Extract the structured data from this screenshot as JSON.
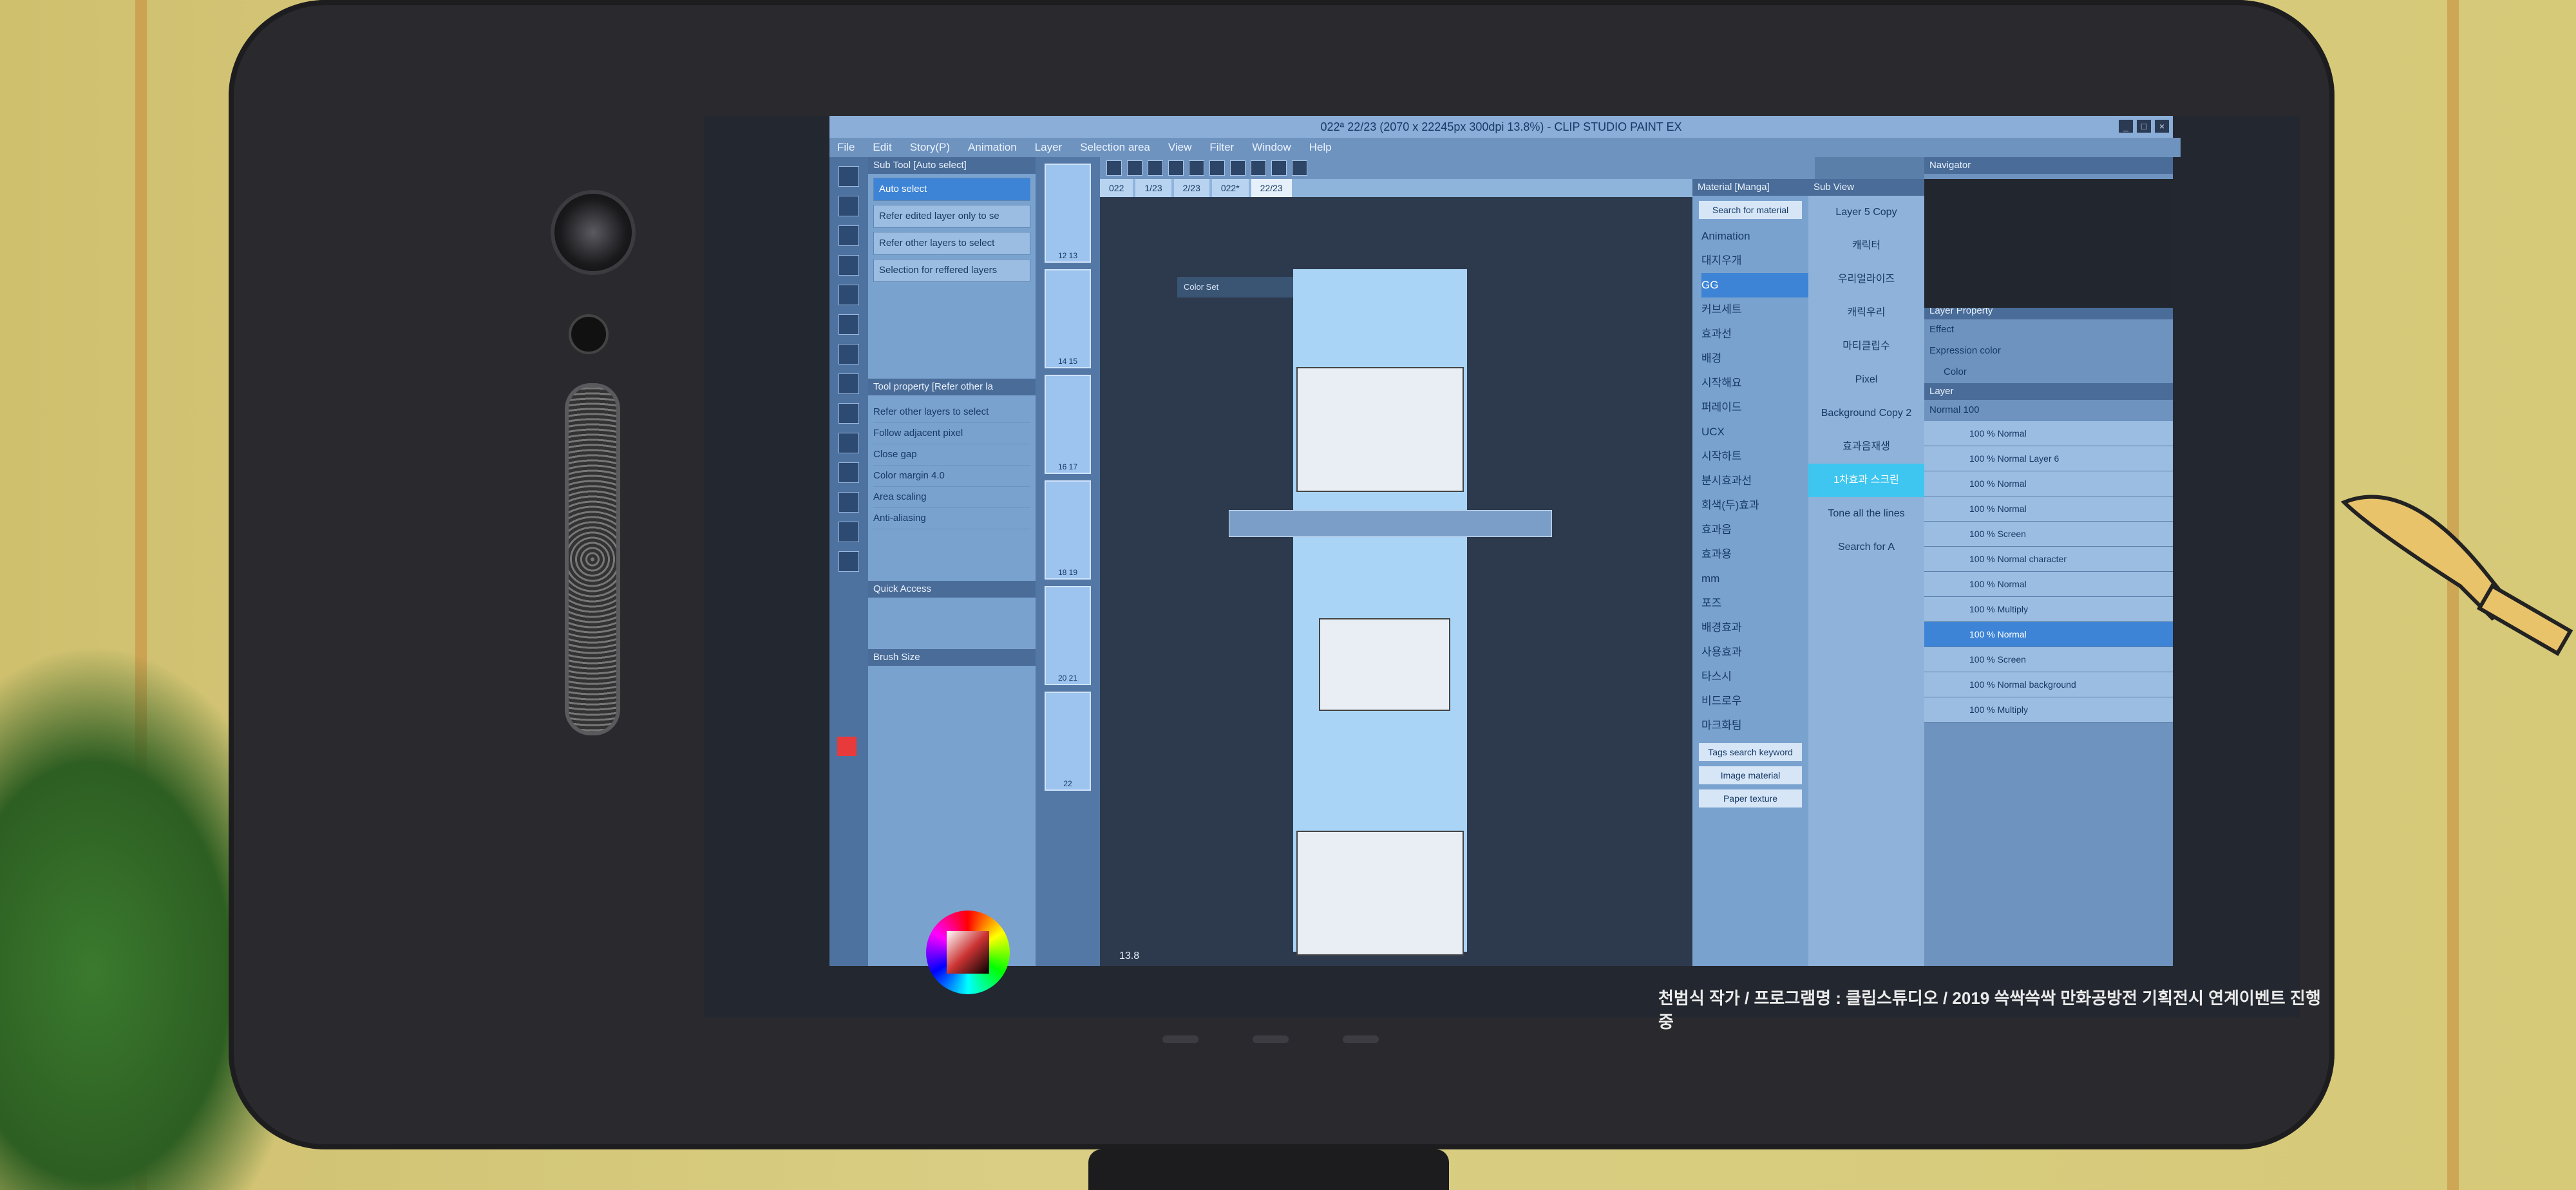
{
  "window": {
    "title": "022ª 22/23 (2070 x 22245px 300dpi 13.8%) - CLIP STUDIO PAINT EX"
  },
  "menu": [
    "File",
    "Edit",
    "Story(P)",
    "Animation",
    "Layer",
    "Selection area",
    "View",
    "Filter",
    "Window",
    "Help"
  ],
  "subtool": {
    "header": "Sub Tool [Auto select]",
    "items": [
      "Auto select",
      "Refer edited layer only to se",
      "Refer other layers to select",
      "Selection for reffered layers"
    ],
    "selected": 0,
    "prop_header": "Tool property [Refer other la",
    "prop_title": "Refer other layers to select",
    "props": [
      "Follow adjacent pixel",
      "Close gap",
      "Color margin",
      "Area scaling",
      "Anti-aliasing"
    ],
    "color_margin_value": "4.0",
    "quick_access": "Quick Access",
    "brush_size": "Brush Size"
  },
  "tabs": [
    "022",
    "1/23",
    "2/23",
    "022*",
    "22/23"
  ],
  "active_tab": 4,
  "color_set_label": "Color Set",
  "zoom_text": "13.8",
  "thumbs": [
    "12 13",
    "14 15",
    "16 17",
    "18 19",
    "20 21",
    "22"
  ],
  "material": {
    "header": "Material [Manga]",
    "search": "Search for material",
    "folders": [
      "Animation",
      "대지우개",
      "GG",
      "커브세트",
      "효과선",
      "배경",
      "시작해요",
      "퍼레이드",
      "UCX",
      "시작하트",
      "분시효과선",
      "회색(두)효과",
      "효과음",
      "효과용",
      "mm",
      "포즈",
      "배경효과",
      "사용효과",
      "타스시",
      "비드로우",
      "마크화팀"
    ],
    "selected": 2,
    "buttons": [
      "Tags search keyword",
      "Image material",
      "Paper texture"
    ]
  },
  "subview": {
    "header": "Sub View",
    "items": [
      "Layer 5 Copy",
      "캐릭터",
      "우리얼라이즈",
      "캐릭우리",
      "마티클립수",
      "Pixel",
      "Background Copy 2",
      "효과음재생",
      "1차효과 스크린",
      "Tone all the lines"
    ],
    "highlighted": 8,
    "bottom": "Search for A"
  },
  "right": {
    "navigator": "Navigator",
    "layer_property": "Layer Property",
    "effect": "Effect",
    "expression_color": "Expression color",
    "expression_value": "Color",
    "layer_header": "Layer",
    "blend_mode": "Normal",
    "opacity": "100",
    "layers": [
      "100 % Normal",
      "100 % Normal Layer 6",
      "100 % Normal",
      "100 % Normal",
      "100 % Screen",
      "100 % Normal character",
      "100 % Normal",
      "100 % Multiply",
      "100 % Normal",
      "100 % Screen",
      "100 % Normal background",
      "100 % Multiply"
    ],
    "selected": 8
  },
  "caption": "천범식 작가 / 프로그램명 : 클립스튜디오 / 2019 쓱싹쓱싹 만화공방전 기획전시 연계이벤트 진행중",
  "colors": {
    "accent": "#3d84d6",
    "highlight": "#3fc6f0",
    "main_color": "#e83a3a"
  }
}
